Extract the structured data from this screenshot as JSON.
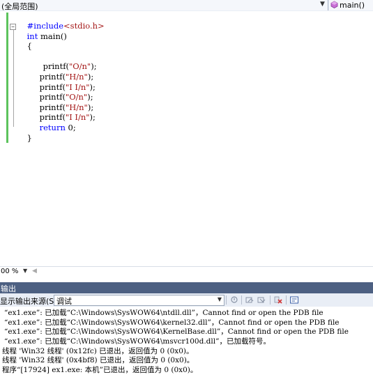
{
  "navbar": {
    "scope": "(全局范围)",
    "member": "main()"
  },
  "editor": {
    "code": {
      "include_directive": "#include",
      "include_file": "<stdio.h>",
      "fold_collapse_glyph": "⊟",
      "int_kw": "int",
      "main_sig": " main()",
      "open_brace": "{",
      "printf_1": "printf(",
      "str_1": "\"O/n\"",
      "end_1": ");",
      "printf_2": "printf(",
      "str_2": "\"H/n\"",
      "end_2": ");",
      "printf_3": "printf(",
      "str_3": "\"I I/n\"",
      "end_3": ");",
      "printf_4": "printf(",
      "str_4": "\"O/n\"",
      "end_4": ");",
      "printf_5": "printf(",
      "str_5": "\"H/n\"",
      "end_5": ");",
      "printf_6": "printf(",
      "str_6": "\"I I/n\"",
      "end_6": ");",
      "return_kw": "return",
      "return_val": " 0;",
      "close_brace": "}"
    }
  },
  "zoom": {
    "value": "00 %"
  },
  "output": {
    "title": "输出",
    "source_label": "显示输出来源(S):",
    "source_value": "调试",
    "lines": [
      "“ex1.exe”: 已加载“C:\\Windows\\SysWOW64\\ntdll.dll”，Cannot find or open the PDB file",
      "“ex1.exe”: 已加载“C:\\Windows\\SysWOW64\\kernel32.dll”，Cannot find or open the PDB file",
      "“ex1.exe”: 已加载“C:\\Windows\\SysWOW64\\KernelBase.dll”，Cannot find or open the PDB file",
      "“ex1.exe”: 已加载“C:\\Windows\\SysWOW64\\msvcr100d.dll”，已加载符号。",
      "线程 'Win32 线程' (0x12fc) 已退出，返回值为 0 (0x0)。",
      "线程 'Win32 线程' (0x4bf8) 已退出，返回值为 0 (0x0)。",
      "程序“[17924] ex1.exe: 本机”已退出，返回值为 0 (0x0)。"
    ]
  },
  "colors": {
    "keyword": "#0000ff",
    "string": "#a31515",
    "change_bar": "#5cc35c",
    "output_title_bg": "#4d6082"
  }
}
